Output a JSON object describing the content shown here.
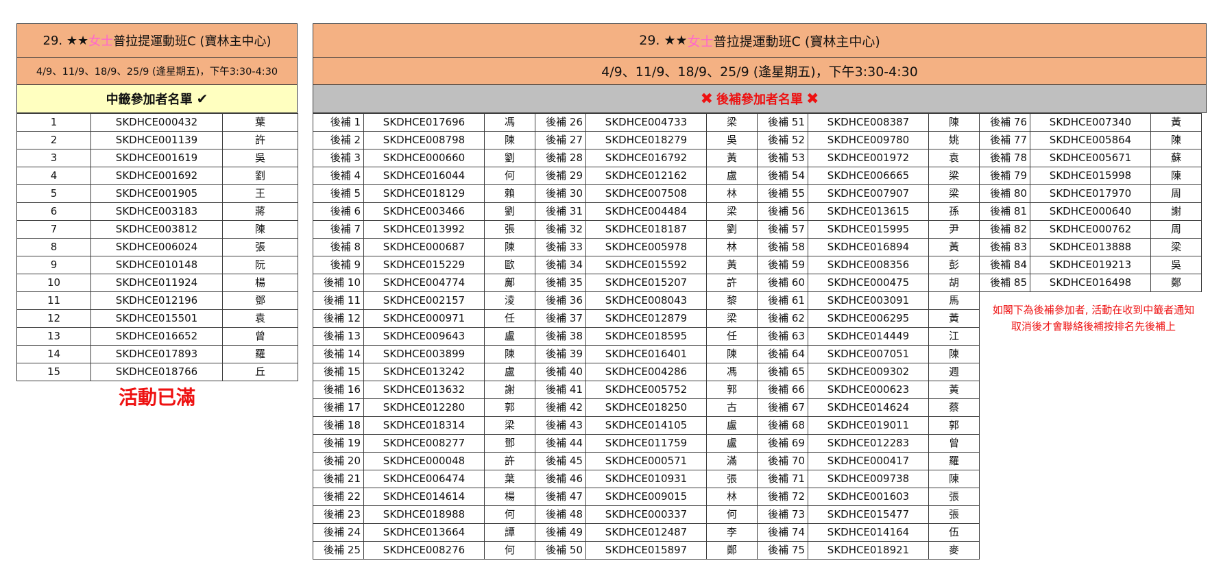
{
  "title_prefix": "29. ★★",
  "title_highlight": "女士",
  "title_suffix": "普拉提運動班C (寶林主中心)",
  "schedule": "4/9、11/9、18/9、25/9 (逢星期五)，下午3:30-4:30",
  "winners_heading": "中籤參加者名單",
  "waitlist_heading": "後補參加者名單",
  "full_text": "活動已滿",
  "note_line1": "如閣下為後補參加者, 活動在收到中籤者通知",
  "note_line2": "取消後才會聯絡後補按排名先後補上",
  "colors": {
    "header_bg": "#f4b183",
    "winners_bg": "#ffffc0",
    "waitlist_bg": "#bfbfbf",
    "accent_red": "#ee1111",
    "highlight_pink": "#ff66cc"
  },
  "winners": [
    [
      "1",
      "SKDHCE000432",
      "葉"
    ],
    [
      "2",
      "SKDHCE001139",
      "許"
    ],
    [
      "3",
      "SKDHCE001619",
      "吳"
    ],
    [
      "4",
      "SKDHCE001692",
      "劉"
    ],
    [
      "5",
      "SKDHCE001905",
      "王"
    ],
    [
      "6",
      "SKDHCE003183",
      "蔣"
    ],
    [
      "7",
      "SKDHCE003812",
      "陳"
    ],
    [
      "8",
      "SKDHCE006024",
      "張"
    ],
    [
      "9",
      "SKDHCE010148",
      "阮"
    ],
    [
      "10",
      "SKDHCE011924",
      "楊"
    ],
    [
      "11",
      "SKDHCE012196",
      "鄧"
    ],
    [
      "12",
      "SKDHCE015501",
      "袁"
    ],
    [
      "13",
      "SKDHCE016652",
      "曾"
    ],
    [
      "14",
      "SKDHCE017893",
      "羅"
    ],
    [
      "15",
      "SKDHCE018766",
      "丘"
    ]
  ],
  "waitlist": [
    [
      "後補 1",
      "SKDHCE017696",
      "馮"
    ],
    [
      "後補 2",
      "SKDHCE008798",
      "陳"
    ],
    [
      "後補 3",
      "SKDHCE000660",
      "劉"
    ],
    [
      "後補 4",
      "SKDHCE016044",
      "何"
    ],
    [
      "後補 5",
      "SKDHCE018129",
      "賴"
    ],
    [
      "後補 6",
      "SKDHCE003466",
      "劉"
    ],
    [
      "後補 7",
      "SKDHCE013992",
      "張"
    ],
    [
      "後補 8",
      "SKDHCE000687",
      "陳"
    ],
    [
      "後補 9",
      "SKDHCE015229",
      "歐"
    ],
    [
      "後補 10",
      "SKDHCE004774",
      "鄺"
    ],
    [
      "後補 11",
      "SKDHCE002157",
      "淩"
    ],
    [
      "後補 12",
      "SKDHCE000971",
      "任"
    ],
    [
      "後補 13",
      "SKDHCE009643",
      "盧"
    ],
    [
      "後補 14",
      "SKDHCE003899",
      "陳"
    ],
    [
      "後補 15",
      "SKDHCE013242",
      "盧"
    ],
    [
      "後補 16",
      "SKDHCE013632",
      "謝"
    ],
    [
      "後補 17",
      "SKDHCE012280",
      "郭"
    ],
    [
      "後補 18",
      "SKDHCE018314",
      "梁"
    ],
    [
      "後補 19",
      "SKDHCE008277",
      "鄧"
    ],
    [
      "後補 20",
      "SKDHCE000048",
      "許"
    ],
    [
      "後補 21",
      "SKDHCE006474",
      "葉"
    ],
    [
      "後補 22",
      "SKDHCE014614",
      "楊"
    ],
    [
      "後補 23",
      "SKDHCE018988",
      "何"
    ],
    [
      "後補 24",
      "SKDHCE013664",
      "譚"
    ],
    [
      "後補 25",
      "SKDHCE008276",
      "何"
    ],
    [
      "後補 26",
      "SKDHCE004733",
      "梁"
    ],
    [
      "後補 27",
      "SKDHCE018279",
      "吳"
    ],
    [
      "後補 28",
      "SKDHCE016792",
      "黃"
    ],
    [
      "後補 29",
      "SKDHCE012162",
      "盧"
    ],
    [
      "後補 30",
      "SKDHCE007508",
      "林"
    ],
    [
      "後補 31",
      "SKDHCE004484",
      "梁"
    ],
    [
      "後補 32",
      "SKDHCE018187",
      "劉"
    ],
    [
      "後補 33",
      "SKDHCE005978",
      "林"
    ],
    [
      "後補 34",
      "SKDHCE015592",
      "黃"
    ],
    [
      "後補 35",
      "SKDHCE015207",
      "許"
    ],
    [
      "後補 36",
      "SKDHCE008043",
      "黎"
    ],
    [
      "後補 37",
      "SKDHCE012879",
      "梁"
    ],
    [
      "後補 38",
      "SKDHCE018595",
      "任"
    ],
    [
      "後補 39",
      "SKDHCE016401",
      "陳"
    ],
    [
      "後補 40",
      "SKDHCE004286",
      "馮"
    ],
    [
      "後補 41",
      "SKDHCE005752",
      "郭"
    ],
    [
      "後補 42",
      "SKDHCE018250",
      "古"
    ],
    [
      "後補 43",
      "SKDHCE014105",
      "盧"
    ],
    [
      "後補 44",
      "SKDHCE011759",
      "盧"
    ],
    [
      "後補 45",
      "SKDHCE000571",
      "滿"
    ],
    [
      "後補 46",
      "SKDHCE010931",
      "張"
    ],
    [
      "後補 47",
      "SKDHCE009015",
      "林"
    ],
    [
      "後補 48",
      "SKDHCE000337",
      "何"
    ],
    [
      "後補 49",
      "SKDHCE012487",
      "李"
    ],
    [
      "後補 50",
      "SKDHCE015897",
      "鄭"
    ],
    [
      "後補 51",
      "SKDHCE008387",
      "陳"
    ],
    [
      "後補 52",
      "SKDHCE009780",
      "姚"
    ],
    [
      "後補 53",
      "SKDHCE001972",
      "袁"
    ],
    [
      "後補 54",
      "SKDHCE006665",
      "梁"
    ],
    [
      "後補 55",
      "SKDHCE007907",
      "梁"
    ],
    [
      "後補 56",
      "SKDHCE013615",
      "孫"
    ],
    [
      "後補 57",
      "SKDHCE015995",
      "尹"
    ],
    [
      "後補 58",
      "SKDHCE016894",
      "黃"
    ],
    [
      "後補 59",
      "SKDHCE008356",
      "彭"
    ],
    [
      "後補 60",
      "SKDHCE000475",
      "胡"
    ],
    [
      "後補 61",
      "SKDHCE003091",
      "馬"
    ],
    [
      "後補 62",
      "SKDHCE006295",
      "黃"
    ],
    [
      "後補 63",
      "SKDHCE014449",
      "江"
    ],
    [
      "後補 64",
      "SKDHCE007051",
      "陳"
    ],
    [
      "後補 65",
      "SKDHCE009302",
      "週"
    ],
    [
      "後補 66",
      "SKDHCE000623",
      "黃"
    ],
    [
      "後補 67",
      "SKDHCE014624",
      "蔡"
    ],
    [
      "後補 68",
      "SKDHCE019011",
      "郭"
    ],
    [
      "後補 69",
      "SKDHCE012283",
      "曾"
    ],
    [
      "後補 70",
      "SKDHCE000417",
      "羅"
    ],
    [
      "後補 71",
      "SKDHCE009738",
      "陳"
    ],
    [
      "後補 72",
      "SKDHCE001603",
      "張"
    ],
    [
      "後補 73",
      "SKDHCE015477",
      "張"
    ],
    [
      "後補 74",
      "SKDHCE014164",
      "伍"
    ],
    [
      "後補 75",
      "SKDHCE018921",
      "麥"
    ],
    [
      "後補 76",
      "SKDHCE007340",
      "黃"
    ],
    [
      "後補 77",
      "SKDHCE005864",
      "陳"
    ],
    [
      "後補 78",
      "SKDHCE005671",
      "蘇"
    ],
    [
      "後補 79",
      "SKDHCE015998",
      "陳"
    ],
    [
      "後補 80",
      "SKDHCE017970",
      "周"
    ],
    [
      "後補 81",
      "SKDHCE000640",
      "謝"
    ],
    [
      "後補 82",
      "SKDHCE000762",
      "周"
    ],
    [
      "後補 83",
      "SKDHCE013888",
      "梁"
    ],
    [
      "後補 84",
      "SKDHCE019213",
      "吳"
    ],
    [
      "後補 85",
      "SKDHCE016498",
      "鄭"
    ]
  ]
}
